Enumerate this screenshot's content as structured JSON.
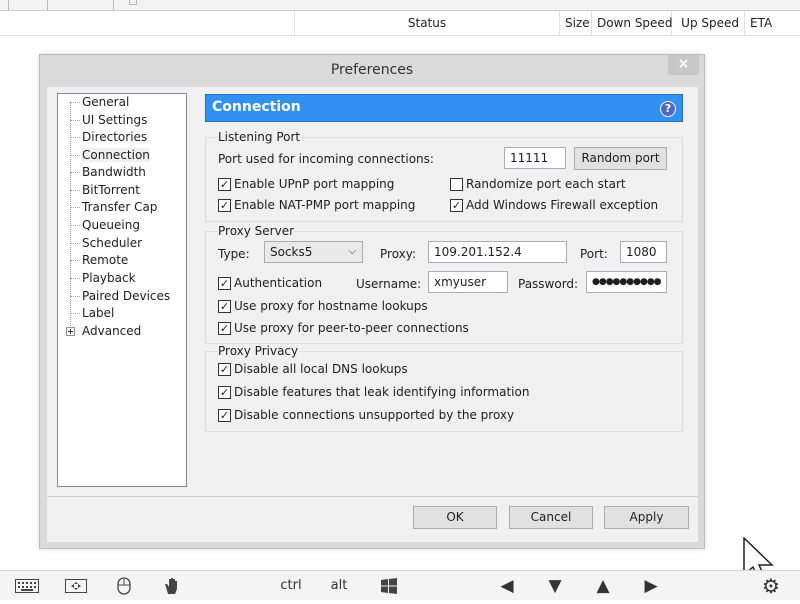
{
  "background": {
    "columns": [
      {
        "key": "status",
        "label": "Status"
      },
      {
        "key": "size",
        "label": "Size"
      },
      {
        "key": "down_speed",
        "label": "Down Speed"
      },
      {
        "key": "up_speed",
        "label": "Up Speed"
      },
      {
        "key": "eta",
        "label": "ETA"
      }
    ]
  },
  "dialog": {
    "title": "Preferences",
    "close_glyph": "×",
    "sidebar": {
      "items": [
        {
          "label": "General"
        },
        {
          "label": "UI Settings"
        },
        {
          "label": "Directories"
        },
        {
          "label": "Connection",
          "selected": true
        },
        {
          "label": "Bandwidth"
        },
        {
          "label": "BitTorrent"
        },
        {
          "label": "Transfer Cap"
        },
        {
          "label": "Queueing"
        },
        {
          "label": "Scheduler"
        },
        {
          "label": "Remote"
        },
        {
          "label": "Playback"
        },
        {
          "label": "Paired Devices"
        },
        {
          "label": "Label"
        },
        {
          "label": "Advanced",
          "expandable": true
        }
      ]
    },
    "header": {
      "title": "Connection",
      "help_icon": "question-mark",
      "help_glyph": "?",
      "color": "#3091f2"
    },
    "listening_port": {
      "group_title": "Listening Port",
      "port_label": "Port used for incoming connections:",
      "port_value": "11111",
      "random_port_label": "Random port",
      "upnp": {
        "label": "Enable UPnP port mapping",
        "checked": true
      },
      "randomize": {
        "label": "Randomize port each start",
        "checked": false
      },
      "natpmp": {
        "label": "Enable NAT-PMP port mapping",
        "checked": true
      },
      "firewall": {
        "label": "Add Windows Firewall exception",
        "checked": true
      }
    },
    "proxy_server": {
      "group_title": "Proxy Server",
      "type_label": "Type:",
      "type_value": "Socks5",
      "proxy_label": "Proxy:",
      "proxy_value": "109.201.152.4",
      "port_label": "Port:",
      "port_value": "1080",
      "auth": {
        "label": "Authentication",
        "checked": true
      },
      "username_label": "Username:",
      "username_value": "xmyuser",
      "password_label": "Password:",
      "password_value": "●●●●●●●●●●",
      "hostname": {
        "label": "Use proxy for hostname lookups",
        "checked": true
      },
      "p2p": {
        "label": "Use proxy for peer-to-peer connections",
        "checked": true
      }
    },
    "proxy_privacy": {
      "group_title": "Proxy Privacy",
      "dns": {
        "label": "Disable all local DNS lookups",
        "checked": true
      },
      "leak": {
        "label": "Disable features that leak identifying information",
        "checked": true
      },
      "unsupported": {
        "label": "Disable connections unsupported by the proxy",
        "checked": true
      }
    },
    "check_glyph": "✓",
    "buttons": {
      "ok": "OK",
      "cancel": "Cancel",
      "apply": "Apply"
    }
  },
  "taskbar": {
    "keyboard_icon": "keyboard-icon",
    "ctrl": "ctrl",
    "alt": "alt",
    "left_glyph": "◀",
    "down_glyph": "▼",
    "up_glyph": "▲",
    "right_glyph": "▶",
    "gear_glyph": "⚙"
  }
}
